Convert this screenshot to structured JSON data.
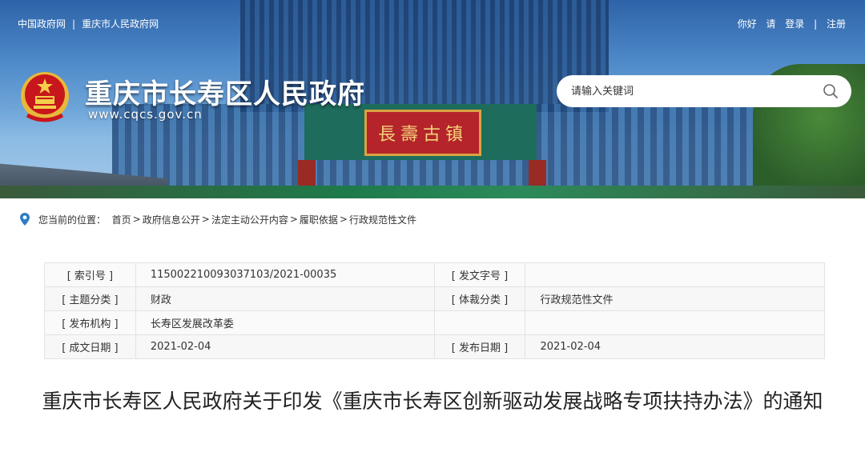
{
  "top_links": {
    "gov": "中国政府网",
    "separator": "|",
    "city": "重庆市人民政府网"
  },
  "user_links": {
    "greeting": "你好",
    "please": "请",
    "login": "登录",
    "separator": "|",
    "register": "注册"
  },
  "site": {
    "title": "重庆市长寿区人民政府",
    "url": "www.cqcs.gov.cn",
    "plaque": "長壽古镇"
  },
  "search": {
    "placeholder": "请输入关键词"
  },
  "breadcrumb": {
    "prefix": "您当前的位置：",
    "items": [
      "首页",
      "政府信息公开",
      "法定主动公开内容",
      "履职依据",
      "行政规范性文件"
    ],
    "separator": ">"
  },
  "meta_table": {
    "rows": [
      {
        "label1": "[ 索引号 ]",
        "value1": "11500221009303710З/2021-00035",
        "label2": "[ 发文字号 ]",
        "value2": ""
      },
      {
        "label1": "[ 主题分类 ]",
        "value1": "财政",
        "label2": "[ 体裁分类 ]",
        "value2": "行政规范性文件"
      },
      {
        "label1": "[ 发布机构 ]",
        "value1": "长寿区发展改革委",
        "label2": "",
        "value2": ""
      },
      {
        "label1": "[ 成文日期 ]",
        "value1": "2021-02-04",
        "label2": "[ 发布日期 ]",
        "value2": "2021-02-04"
      }
    ]
  },
  "document": {
    "title": "重庆市长寿区人民政府关于印发《重庆市长寿区创新驱动发展战略专项扶持办法》的通知"
  },
  "colors": {
    "banner_blue": "#2d63a8",
    "emblem_red": "#c8161d",
    "emblem_gold": "#e8b83a"
  }
}
